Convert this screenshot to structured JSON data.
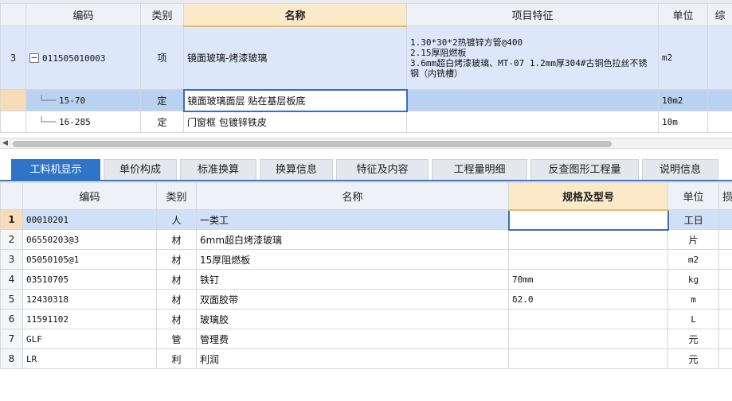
{
  "top_grid": {
    "columns": [
      "编码",
      "类别",
      "名称",
      "项目特征",
      "单位",
      "综"
    ],
    "rows": [
      {
        "num": "3",
        "code": "011505010003",
        "type": "项",
        "name": "镜面玻璃-烤漆玻璃",
        "features": [
          "1.30*30*2热镀锌方管@400",
          "2.15厚阻燃板",
          "3.6mm超白烤漆玻璃、MT-07 1.2mm厚304#古铜色拉丝不锈钢（内铣槽）"
        ],
        "unit": "m2"
      },
      {
        "num": "",
        "code": "15-70",
        "type": "定",
        "name": "镜面玻璃面层 贴在基层板底",
        "features": "",
        "unit": "10m2"
      },
      {
        "num": "",
        "code": "16-285",
        "type": "定",
        "name": "门窗框 包镀锌铁皮",
        "features": "",
        "unit": "10m"
      }
    ]
  },
  "tabs": [
    "工料机显示",
    "单价构成",
    "标准换算",
    "换算信息",
    "特征及内容",
    "工程量明细",
    "反查图形工程量",
    "说明信息"
  ],
  "bottom_grid": {
    "columns": [
      "编码",
      "类别",
      "名称",
      "规格及型号",
      "单位",
      "损"
    ],
    "rows": [
      {
        "num": "1",
        "code": "00010201",
        "type": "人",
        "name": "一类工",
        "spec": "",
        "unit": "工日"
      },
      {
        "num": "2",
        "code": "06550203@3",
        "type": "材",
        "name": "6mm超白烤漆玻璃",
        "spec": "",
        "unit": "片"
      },
      {
        "num": "3",
        "code": "05050105@1",
        "type": "材",
        "name": "15厚阻燃板",
        "spec": "",
        "unit": "m2"
      },
      {
        "num": "4",
        "code": "03510705",
        "type": "材",
        "name": "铁钉",
        "spec": "70mm",
        "unit": "kg"
      },
      {
        "num": "5",
        "code": "12430318",
        "type": "材",
        "name": "双面胶带",
        "spec": "δ2.0",
        "unit": "m"
      },
      {
        "num": "6",
        "code": "11591102",
        "type": "材",
        "name": "玻璃胶",
        "spec": "",
        "unit": "L"
      },
      {
        "num": "7",
        "code": "GLF",
        "type": "管",
        "name": "管理费",
        "spec": "",
        "unit": "元"
      },
      {
        "num": "8",
        "code": "LR",
        "type": "利",
        "name": "利润",
        "spec": "",
        "unit": "元"
      }
    ]
  }
}
